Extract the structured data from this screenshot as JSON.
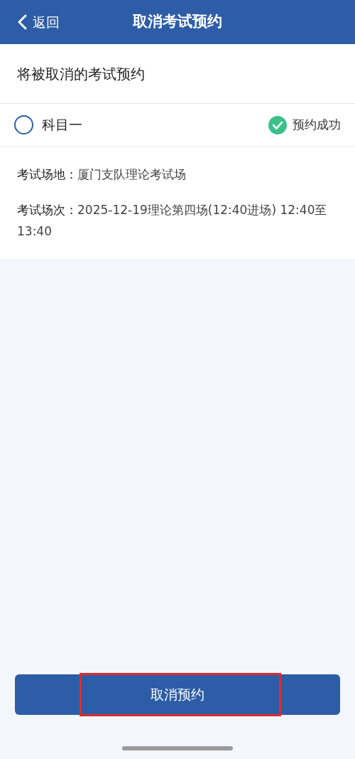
{
  "header": {
    "back": "返回",
    "title": "取消考试预约"
  },
  "section_title": "将被取消的考试预约",
  "subject": {
    "name": "科目一",
    "selected": false,
    "status": "预约成功"
  },
  "details": [
    {
      "label": "考试场地：",
      "value": "厦门支队理论考试场"
    },
    {
      "label": "考试场次：",
      "value": "2025-12-19理论第四场(12:40进场) 12:40至13:40"
    }
  ],
  "button": {
    "label": "取消预约",
    "highlighted": true
  }
}
